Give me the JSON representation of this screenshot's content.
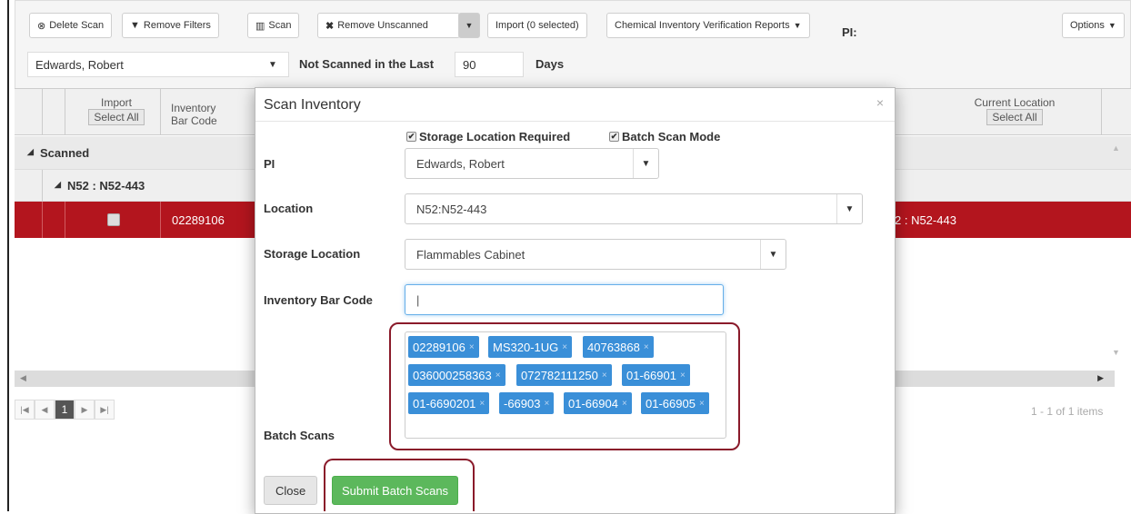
{
  "toolbar": {
    "delete_scan": "Delete Scan",
    "remove_filters": "Remove Filters",
    "scan": "Scan",
    "remove_unscanned": "Remove Unscanned",
    "import": "Import (0 selected)",
    "reports": "Chemical Inventory Verification Reports",
    "pi_label": "PI:",
    "options": "Options",
    "pi_value": "Edwards, Robert",
    "not_scanned_label": "Not Scanned in the Last",
    "days_value": "90",
    "days_label": "Days"
  },
  "grid": {
    "col_import": "Import",
    "col_import_btn": "Select All",
    "col_barcode_1": "Inventory",
    "col_barcode_2": "Bar Code",
    "col_location": "Current Location",
    "col_location_btn": "Select All",
    "group_scanned": "Scanned",
    "group_location": "N52 : N52-443",
    "row_barcode": "02289106",
    "row_location": "2 : N52-443",
    "pager_page": "1",
    "pager_info": "1 - 1 of 1 items"
  },
  "modal": {
    "title": "Scan Inventory",
    "close_x": "×",
    "storage_required": "Storage Location Required",
    "batch_mode": "Batch Scan Mode",
    "pi_label": "PI",
    "pi_value": "Edwards, Robert",
    "location_label": "Location",
    "location_value": "N52:N52-443",
    "storage_label": "Storage Location",
    "storage_value": "Flammables Cabinet",
    "barcode_label": "Inventory Bar Code",
    "barcode_value": "|",
    "batch_label": "Batch Scans",
    "tags": [
      "02289106",
      "MS320-1UG",
      "40763868",
      "036000258363",
      "072782111250",
      "01-66901",
      "01-6690201",
      "-66903",
      "01-66904",
      "01-66905"
    ],
    "close_button": "Close",
    "submit_button": "Submit Batch Scans"
  },
  "colors": {
    "accent_red": "#b3151e",
    "tag_blue": "#3a8fd8",
    "submit_green": "#5cb85c",
    "highlight": "#8a1a2a"
  }
}
